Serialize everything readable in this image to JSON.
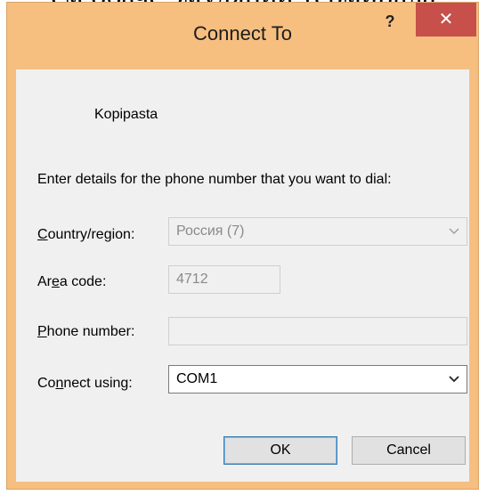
{
  "background": {
    "caption": "…ем обаче эмуляции терминала…"
  },
  "window": {
    "title": "Connect To",
    "help_label": "?",
    "close_label": "✕",
    "colors": {
      "frame": "#f6bf80",
      "close": "#c7504a",
      "content": "#f0f0f0"
    }
  },
  "connection_name": "Kopipasta",
  "instructions": "Enter details for the phone number that you want to dial:",
  "fields": {
    "country": {
      "label_pre": "",
      "label_u": "C",
      "label_post": "ountry/region:",
      "value": "Россия (7)"
    },
    "area": {
      "label_pre": "Ar",
      "label_u": "e",
      "label_post": "a code:",
      "value": "4712"
    },
    "phone": {
      "label_pre": "",
      "label_u": "P",
      "label_post": "hone number:",
      "value": ""
    },
    "connect": {
      "label_pre": "Co",
      "label_u": "n",
      "label_post": "nect using:",
      "value": "COM1"
    }
  },
  "buttons": {
    "ok": "OK",
    "cancel": "Cancel"
  }
}
